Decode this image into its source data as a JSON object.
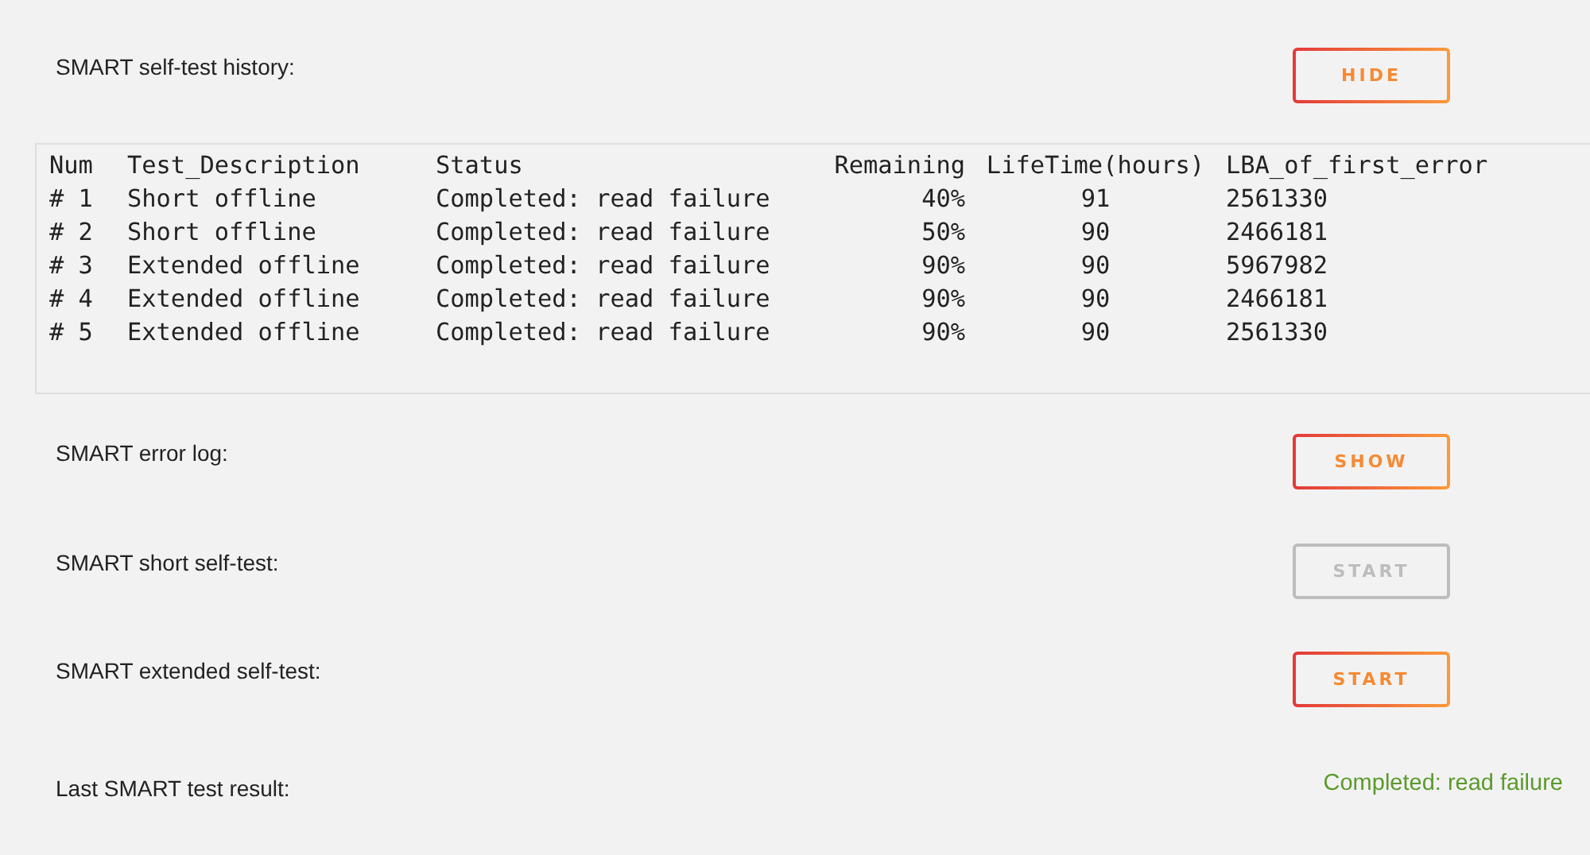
{
  "sections": [
    {
      "kind": "button",
      "label": "SMART self-test history:",
      "button": {
        "label": "HIDE",
        "disabled": false
      }
    },
    {
      "kind": "table",
      "columns": [
        "Num",
        "Test_Description",
        "Status",
        "Remaining",
        "LifeTime(hours)",
        "LBA_of_first_error"
      ],
      "rows": [
        [
          "# 1",
          "Short offline",
          "Completed: read failure",
          "40%",
          "91",
          "2561330"
        ],
        [
          "# 2",
          "Short offline",
          "Completed: read failure",
          "50%",
          "90",
          "2466181"
        ],
        [
          "# 3",
          "Extended offline",
          "Completed: read failure",
          "90%",
          "90",
          "5967982"
        ],
        [
          "# 4",
          "Extended offline",
          "Completed: read failure",
          "90%",
          "90",
          "2466181"
        ],
        [
          "# 5",
          "Extended offline",
          "Completed: read failure",
          "90%",
          "90",
          "2561330"
        ]
      ]
    },
    {
      "kind": "button",
      "label": "SMART error log:",
      "button": {
        "label": "SHOW",
        "disabled": false
      }
    },
    {
      "kind": "button",
      "label": "SMART short self-test:",
      "button": {
        "label": "START",
        "disabled": true
      }
    },
    {
      "kind": "button",
      "label": "SMART extended self-test:",
      "button": {
        "label": "START",
        "disabled": false
      }
    },
    {
      "kind": "value",
      "label": "Last SMART test result:",
      "value": "Completed: read failure"
    }
  ]
}
